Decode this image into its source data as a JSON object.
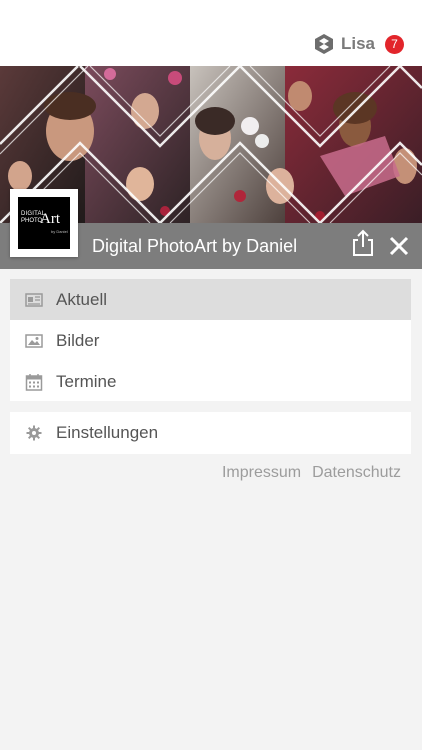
{
  "header": {
    "user_name": "Lisa",
    "notification_count": "7",
    "user_icon": "hexagon-logo-icon",
    "badge_color": "#e2252b"
  },
  "app": {
    "title": "Digital PhotoArt by Daniel",
    "logo": {
      "line1": "DIGITAL",
      "line2": "PHOTO",
      "art": "Art",
      "by": "by Daniel"
    },
    "share_icon": "share-icon",
    "close_icon": "close-icon"
  },
  "menu": {
    "primary": [
      {
        "label": "Aktuell",
        "icon": "news-icon",
        "active": true
      },
      {
        "label": "Bilder",
        "icon": "image-icon",
        "active": false
      },
      {
        "label": "Termine",
        "icon": "calendar-icon",
        "active": false
      }
    ],
    "secondary": [
      {
        "label": "Einstellungen",
        "icon": "gear-icon",
        "active": false
      }
    ]
  },
  "footer": {
    "impressum": "Impressum",
    "datenschutz": "Datenschutz"
  },
  "colors": {
    "titlebar": "#7d7d7d",
    "active_item": "#dddddd",
    "background": "#f3f3f3"
  }
}
